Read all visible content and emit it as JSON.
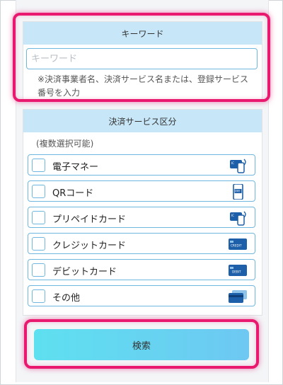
{
  "keyword_section": {
    "header": "キーワード",
    "placeholder": "キーワード",
    "value": "",
    "note": "※決済事業者名、決済サービス名または、登録サービス番号を入力"
  },
  "service_section": {
    "header": "決済サービス区分",
    "subtitle": "(複数選択可能)",
    "options": [
      {
        "label": "電子マネー",
        "icon": "e-money-icon",
        "checked": false
      },
      {
        "label": "QRコード",
        "icon": "phone-pay-icon",
        "checked": false
      },
      {
        "label": "プリペイドカード",
        "icon": "prepaid-card-icon",
        "checked": false
      },
      {
        "label": "クレジットカード",
        "icon": "credit-card-icon",
        "checked": false
      },
      {
        "label": "デビットカード",
        "icon": "debit-card-icon",
        "checked": false
      },
      {
        "label": "その他",
        "icon": "other-card-icon",
        "checked": false
      }
    ]
  },
  "search_button": {
    "label": "検索"
  },
  "colors": {
    "header_bg": "#c7e6f7",
    "border_blue": "#6fb7e0",
    "highlight": "#e8196f",
    "icon_blue": "#1d5fa8",
    "button_gradient": [
      "#5ee0f0",
      "#6ec8f2"
    ]
  }
}
